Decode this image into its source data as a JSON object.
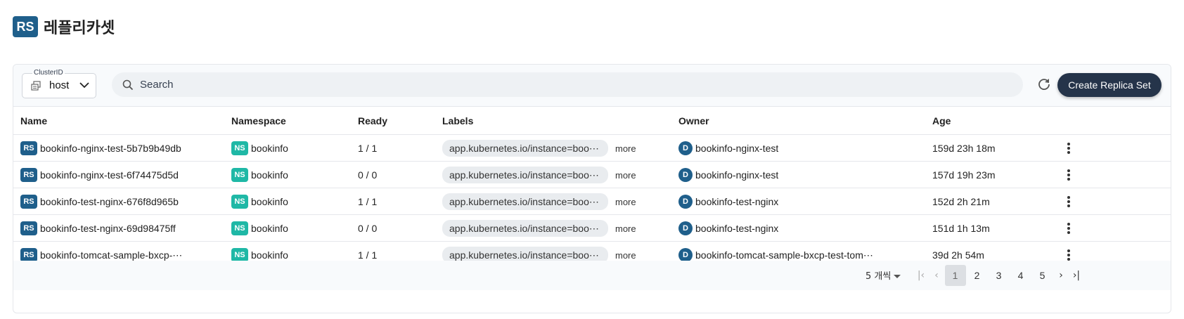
{
  "header": {
    "logo": "RS",
    "title": "레플리카셋"
  },
  "toolbar": {
    "cluster_label": "ClusterID",
    "cluster_value": "host",
    "search_placeholder": "Search",
    "create_label": "Create Replica Set"
  },
  "table": {
    "columns": [
      "Name",
      "Namespace",
      "Ready",
      "Labels",
      "Owner",
      "Age"
    ],
    "rows": [
      {
        "badge": "RS",
        "name": "bookinfo-nginx-test-5b7b9b49db",
        "ns_badge": "NS",
        "namespace": "bookinfo",
        "ready": "1 / 1",
        "label": "app.kubernetes.io/instance=boo⋯",
        "more": "more",
        "owner_badge": "D",
        "owner": "bookinfo-nginx-test",
        "age": "159d 23h 18m"
      },
      {
        "badge": "RS",
        "name": "bookinfo-nginx-test-6f74475d5d",
        "ns_badge": "NS",
        "namespace": "bookinfo",
        "ready": "0 / 0",
        "label": "app.kubernetes.io/instance=boo⋯",
        "more": "more",
        "owner_badge": "D",
        "owner": "bookinfo-nginx-test",
        "age": "157d 19h 23m"
      },
      {
        "badge": "RS",
        "name": "bookinfo-test-nginx-676f8d965b",
        "ns_badge": "NS",
        "namespace": "bookinfo",
        "ready": "1 / 1",
        "label": "app.kubernetes.io/instance=boo⋯",
        "more": "more",
        "owner_badge": "D",
        "owner": "bookinfo-test-nginx",
        "age": "152d 2h 21m"
      },
      {
        "badge": "RS",
        "name": "bookinfo-test-nginx-69d98475ff",
        "ns_badge": "NS",
        "namespace": "bookinfo",
        "ready": "0 / 0",
        "label": "app.kubernetes.io/instance=boo⋯",
        "more": "more",
        "owner_badge": "D",
        "owner": "bookinfo-test-nginx",
        "age": "151d 1h 13m"
      },
      {
        "badge": "RS",
        "name": "bookinfo-tomcat-sample-bxcp-⋯",
        "ns_badge": "NS",
        "namespace": "bookinfo",
        "ready": "1 / 1",
        "label": "app.kubernetes.io/instance=boo⋯",
        "more": "more",
        "owner_badge": "D",
        "owner": "bookinfo-tomcat-sample-bxcp-test-tom⋯",
        "age": "39d 2h 54m"
      }
    ]
  },
  "pagination": {
    "rows_per_page": "5 개씩",
    "first": "|‹",
    "prev": "‹",
    "next": "›",
    "last": "›|",
    "pages": [
      "1",
      "2",
      "3",
      "4",
      "5"
    ],
    "current_page": "1"
  },
  "colors": {
    "rs_badge": "#1f5f8b",
    "ns_badge": "#1fb8a6",
    "create_button": "#25344a"
  }
}
